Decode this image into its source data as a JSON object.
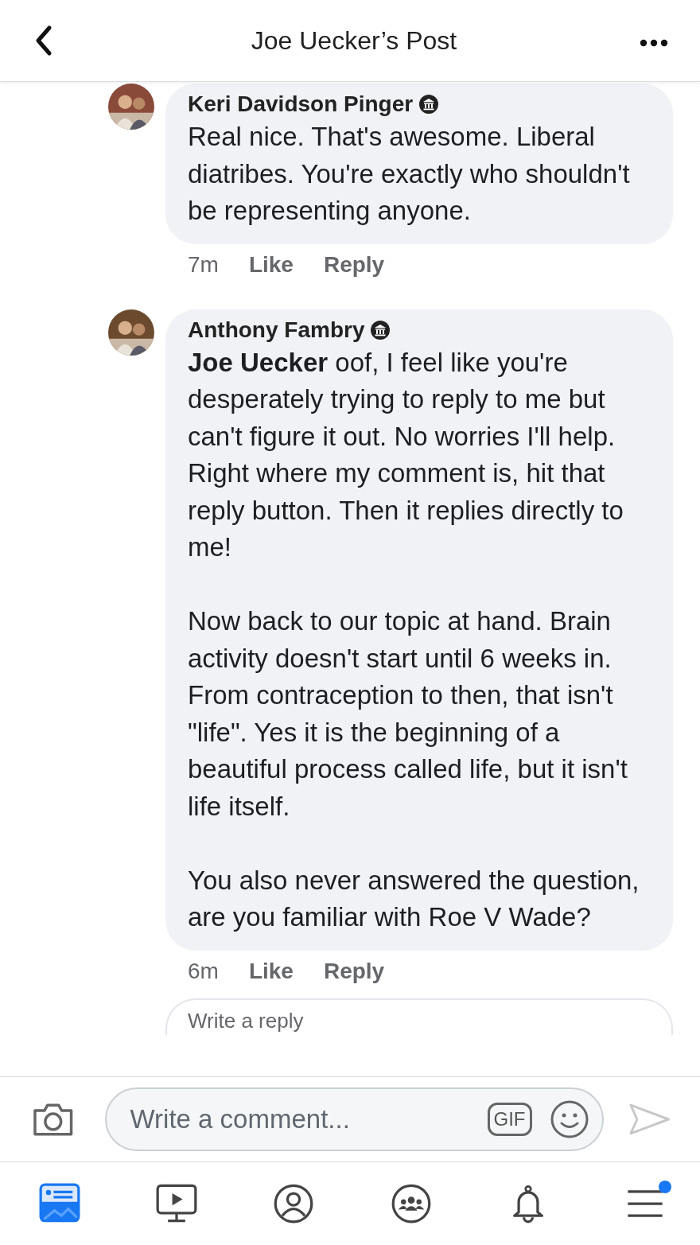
{
  "header": {
    "title": "Joe Uecker’s Post"
  },
  "comments": [
    {
      "author": "Keri Davidson Pinger",
      "avatar": {
        "kind": "picture"
      },
      "paragraphs": [
        "Real nice. That's awesome. Liberal diatribes. You're exactly who shouldn't be representing anyone."
      ],
      "time": "7m",
      "actions": [
        "Like",
        "Reply"
      ]
    },
    {
      "author": "Anthony Fambry",
      "avatar": {
        "kind": "picture"
      },
      "paragraphs": [
        "**Joe Uecker** oof, I feel like you're desperately trying to reply to me but can't figure it out. No worries I'll help. Right where my comment is, hit that reply button. Then it replies directly to me!",
        "Now back to our topic at hand. Brain activity doesn't start until 6 weeks in. From contraception to then, that isn't \"life\". Yes it is the beginning of a beautiful process called life, but it isn't life itself.",
        "You also never answered the question, are you familiar with Roe V Wade?"
      ],
      "time": "6m",
      "actions": [
        "Like",
        "Reply"
      ]
    }
  ],
  "reply_field": {
    "placeholder": "Write a reply"
  },
  "composer": {
    "placeholder": "Write a comment...",
    "gif": "GIF"
  },
  "tabs": [
    {
      "kind": "feed",
      "selected": true,
      "notification_dot": false
    },
    {
      "kind": "video",
      "selected": false,
      "notification_dot": false
    },
    {
      "kind": "profile",
      "selected": false,
      "notification_dot": false
    },
    {
      "kind": "groups",
      "selected": false,
      "notification_dot": false
    },
    {
      "kind": "bell",
      "selected": false,
      "notification_dot": false
    },
    {
      "kind": "menu",
      "selected": false,
      "notification_dot": true
    }
  ]
}
